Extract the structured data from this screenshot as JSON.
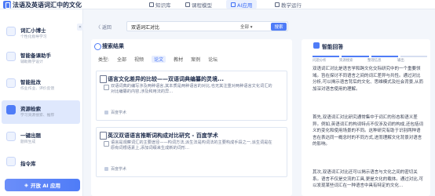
{
  "app": {
    "title": "法语及英语词汇中的文化"
  },
  "nav": [
    {
      "label": "知识库",
      "active": false
    },
    {
      "label": "课程模型",
      "active": false
    },
    {
      "label": "AI应用",
      "active": true
    },
    {
      "label": "教学运行",
      "active": false
    }
  ],
  "sidebar": {
    "collapse": "«",
    "items": [
      {
        "title": "词汇小博士",
        "subtitle": "个性化指导学习",
        "active": false
      },
      {
        "title": "智能备课助手",
        "subtitle": "辅助教学设计",
        "active": false
      },
      {
        "title": "智能批改",
        "subtitle": "作业作业、评价反馈",
        "active": false
      },
      {
        "title": "资源检索",
        "subtitle": "学习资源搜索、推荐",
        "active": true
      },
      {
        "title": "一键出题",
        "subtitle": "题目生成",
        "active": false
      },
      {
        "title": "指令库",
        "subtitle": "",
        "active": false
      }
    ],
    "open_button": "开放 AI 应用"
  },
  "main": {
    "back": "〈 返回",
    "search": {
      "value": "双语词汇对比",
      "scope": "全部",
      "button": "搜索"
    },
    "results_title": "搜索结果",
    "filters_label": "类型:",
    "filters": [
      "全部",
      "视频",
      "论文",
      "教材",
      "案例",
      "论坛"
    ],
    "active_filter": "论文",
    "items": [
      {
        "title": "语言文化差异的比较——双语词典编纂的灵境...",
        "body": "双语词典的编写涉及两种语言,其本质是两种语言的对比,也无其注重对两种语言文化词汇的对比编纂的内容,涉及和用法的异...",
        "source": "百度学术"
      },
      {
        "title": "英汉双语语言推断词构成对比研究 - 百度学术",
        "body": "语言是观察词汇的主要途径——构词方法,派生法是构词法的主要构成手段之一,派生词是在原有词根语素上,添加词缀来生成新的词形...",
        "source": "百度学术"
      }
    ]
  },
  "right": {
    "title": "智能回答",
    "steps": [
      "问题分析",
      "资源搜索",
      "整理信息",
      "输出"
    ],
    "steps_done": 3,
    "paragraphs": [
      "双语词汇对比是语言学和跨文化交际研究中的一个重要领域。旨在探讨不同语言之间的词汇差异与共性。通过对比分析,可以揭示语言背后的文化、思维模式及社会背景,从而加深对语言使用的理解。",
      "首先,双语词汇对比研究通常集中于词汇的形态和语义差异。例如,英语词汇的构词特点不仅涉及词的构成,还包括词义的变化和使用场景的不同。这种研究有助于识别两种语言在表达同一概念时的不同方式,进而理解文化背景对语言的影响。",
      "其次,双语词汇对比还可以揭示语言与文化之间的密切关系。语言不仅是交流的工具,更是文化的载体。通过对比,可以发现某些词汇在一种语言中具有特定的文化..."
    ]
  }
}
